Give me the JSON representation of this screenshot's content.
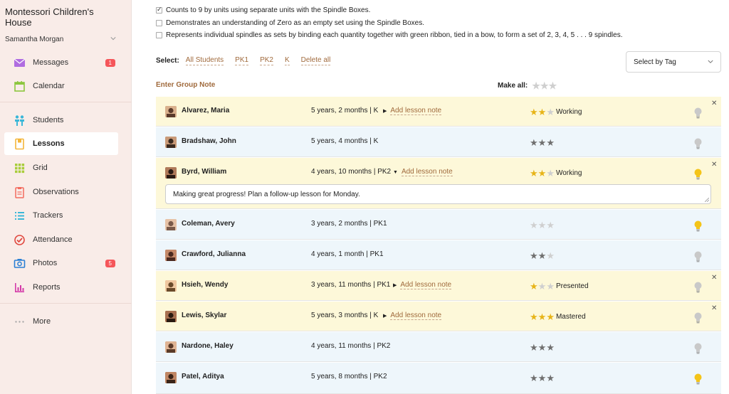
{
  "sidebar": {
    "school_name": "Montessori Children's House",
    "user_name": "Samantha Morgan",
    "items": [
      {
        "label": "Messages",
        "icon": "envelope-icon",
        "badge": "1"
      },
      {
        "label": "Calendar",
        "icon": "calendar-icon",
        "badge": ""
      },
      {
        "label": "Students",
        "icon": "students-icon",
        "badge": ""
      },
      {
        "label": "Lessons",
        "icon": "lessons-icon",
        "badge": ""
      },
      {
        "label": "Grid",
        "icon": "grid-icon",
        "badge": ""
      },
      {
        "label": "Observations",
        "icon": "observations-icon",
        "badge": ""
      },
      {
        "label": "Trackers",
        "icon": "trackers-icon",
        "badge": ""
      },
      {
        "label": "Attendance",
        "icon": "attendance-icon",
        "badge": ""
      },
      {
        "label": "Photos",
        "icon": "camera-icon",
        "badge": "5"
      },
      {
        "label": "Reports",
        "icon": "reports-icon",
        "badge": ""
      },
      {
        "label": "More",
        "icon": "more-icon",
        "badge": ""
      }
    ],
    "active_item": "Lessons"
  },
  "criteria": [
    {
      "text": "Counts to 9 by units using separate units with the Spindle Boxes.",
      "checked": true
    },
    {
      "text": "Demonstrates an understanding of Zero as an empty set using the Spindle Boxes.",
      "checked": false
    },
    {
      "text": "Represents individual spindles as sets by binding each quantity together with green ribbon, tied in a bow, to form a set of 2, 3, 4, 5 . . . 9 spindles.",
      "checked": false
    }
  ],
  "select_bar": {
    "label": "Select:",
    "options": [
      "All Students",
      "PK1",
      "PK2",
      "K",
      "Delete all"
    ]
  },
  "tag_select": {
    "value": "Select by Tag"
  },
  "group_note_label": "Enter Group Note",
  "make_all_label": "Make all:",
  "students": [
    {
      "name": "Alvarez, Maria",
      "age": "5 years, 2 months | K",
      "note_link": "Add lesson note",
      "rating": 2,
      "status": "Working",
      "bulb_lit": false,
      "removable": true,
      "expanded": false,
      "note": ""
    },
    {
      "name": "Bradshaw, John",
      "age": "5 years, 4 months | K",
      "note_link": "",
      "rating": 3,
      "status": "",
      "bulb_lit": false,
      "removable": false,
      "expanded": false,
      "note": ""
    },
    {
      "name": "Byrd, William",
      "age": "4 years, 10 months | PK2",
      "note_link": "Add lesson note",
      "rating": 2,
      "status": "Working",
      "bulb_lit": true,
      "removable": true,
      "expanded": true,
      "note": "Making great progress! Plan a follow-up lesson for Monday."
    },
    {
      "name": "Coleman, Avery",
      "age": "3 years, 2 months | PK1",
      "note_link": "",
      "rating": 0,
      "status": "",
      "bulb_lit": true,
      "removable": false,
      "expanded": false,
      "note": ""
    },
    {
      "name": "Crawford, Julianna",
      "age": "4 years, 1 month | PK1",
      "note_link": "",
      "rating": 2,
      "status": "",
      "bulb_lit": false,
      "removable": false,
      "expanded": false,
      "note": ""
    },
    {
      "name": "Hsieh, Wendy",
      "age": "3 years, 11 months | PK1",
      "note_link": "Add lesson note",
      "rating": 1,
      "status": "Presented",
      "bulb_lit": false,
      "removable": true,
      "expanded": false,
      "note": ""
    },
    {
      "name": "Lewis, Skylar",
      "age": "5 years, 3 months | K",
      "note_link": "Add lesson note",
      "rating": 3,
      "status": "Mastered",
      "bulb_lit": false,
      "removable": true,
      "expanded": false,
      "note": ""
    },
    {
      "name": "Nardone, Haley",
      "age": "4 years, 11 months | PK2",
      "note_link": "",
      "rating": 3,
      "status": "",
      "bulb_lit": false,
      "removable": false,
      "expanded": false,
      "note": ""
    },
    {
      "name": "Patel, Aditya",
      "age": "5 years, 8 months | PK2",
      "note_link": "",
      "rating": 3,
      "status": "",
      "bulb_lit": true,
      "removable": false,
      "expanded": false,
      "note": ""
    }
  ],
  "colors": {
    "accent_link": "#a06a3c",
    "badge": "#f5565a",
    "gold_star": "#e7b418",
    "row_yellow": "#fdf8d9",
    "row_blue": "#eef6fb"
  }
}
